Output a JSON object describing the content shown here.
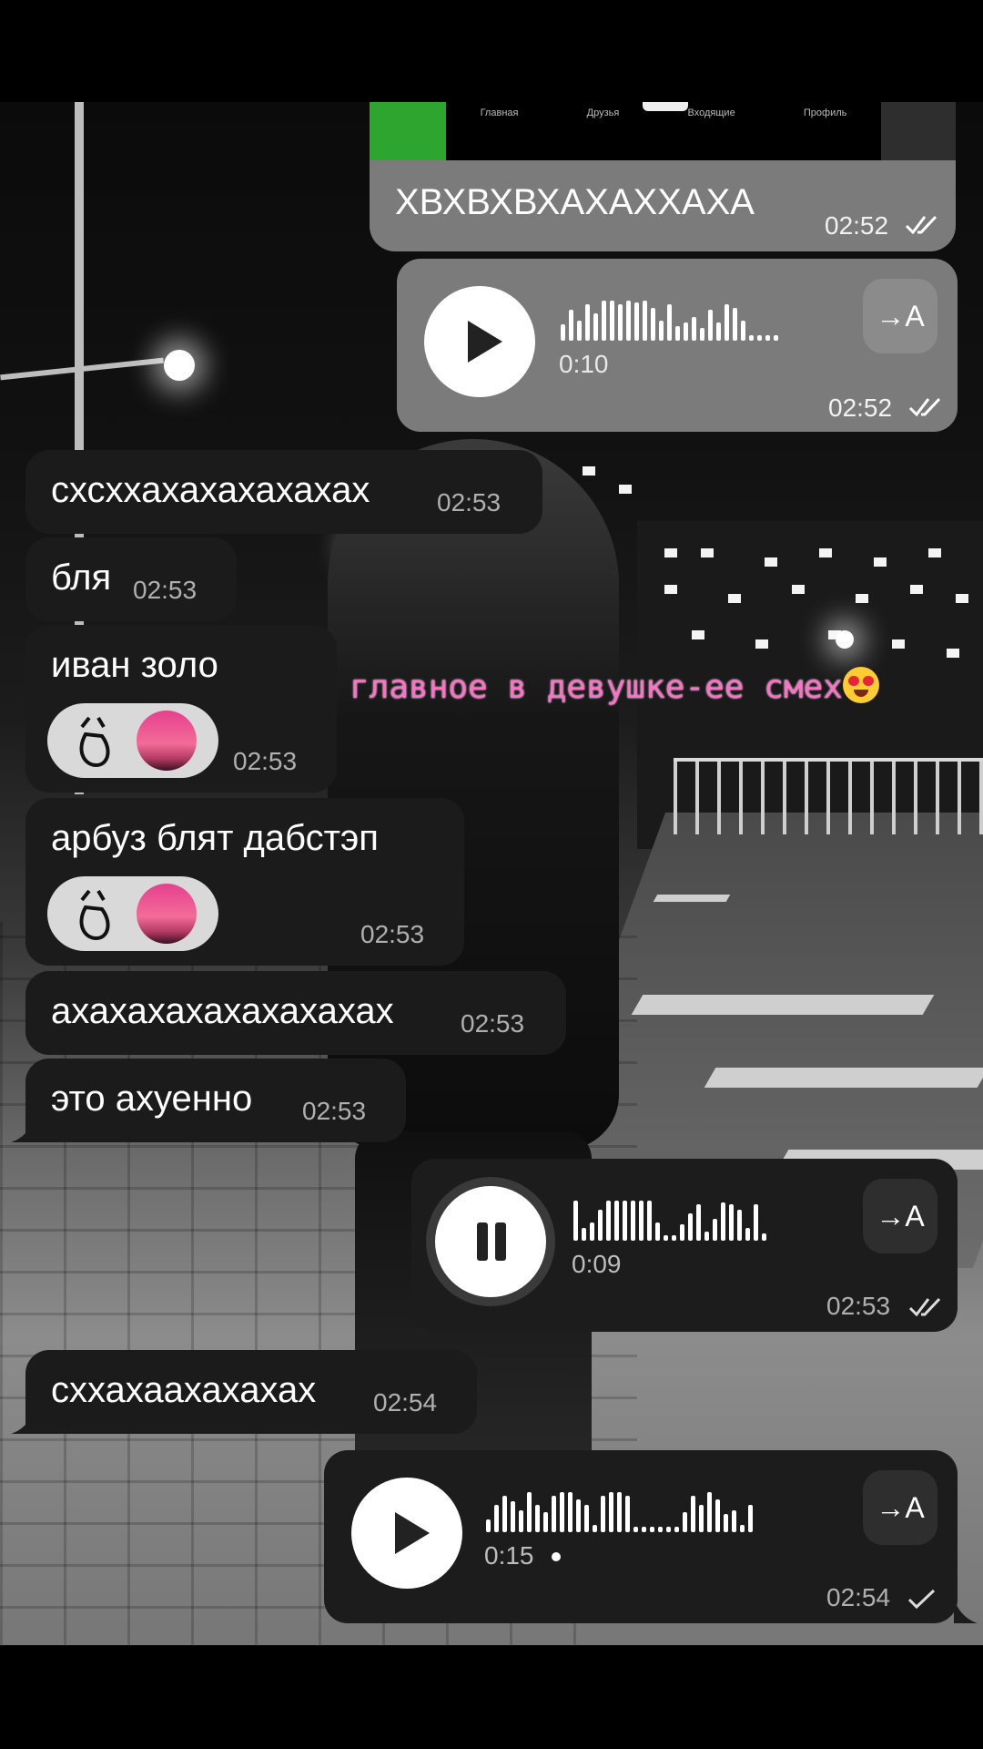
{
  "top_strip": {
    "tabs": [
      "Главная",
      "Друзья",
      "Входящие",
      "Профиль"
    ]
  },
  "messages": [
    {
      "text": "ХВХВХВХАХАХХАХА",
      "time": "02:52",
      "status": "read"
    },
    {
      "voice_duration": "0:10",
      "translate_label": "→A",
      "time": "02:52",
      "status": "read",
      "state": "play"
    },
    {
      "text": "схсххахахахахахах",
      "time": "02:53"
    },
    {
      "text": "бля",
      "time": "02:53"
    },
    {
      "text": "иван золо",
      "time": "02:53"
    },
    {
      "text": "арбуз блят дабстэп",
      "time": "02:53"
    },
    {
      "text": "ахахахахахахахахах",
      "time": "02:53"
    },
    {
      "text": "это ахуенно",
      "time": "02:53"
    },
    {
      "voice_duration": "0:09",
      "translate_label": "→A",
      "time": "02:53",
      "status": "read",
      "state": "pause"
    },
    {
      "text": "сххахаахахахах",
      "time": "02:54"
    },
    {
      "voice_duration": "0:15",
      "translate_label": "→A",
      "time": "02:54",
      "status": "sent",
      "state": "play"
    }
  ],
  "overlay_caption": "главное в девушке-ее смех",
  "colors": {
    "incoming": "#1b1b1b",
    "outgoing_grey": "#7b7b7b",
    "outgoing_dark": "#1c1c1c",
    "caption": "#ff6ec7"
  }
}
